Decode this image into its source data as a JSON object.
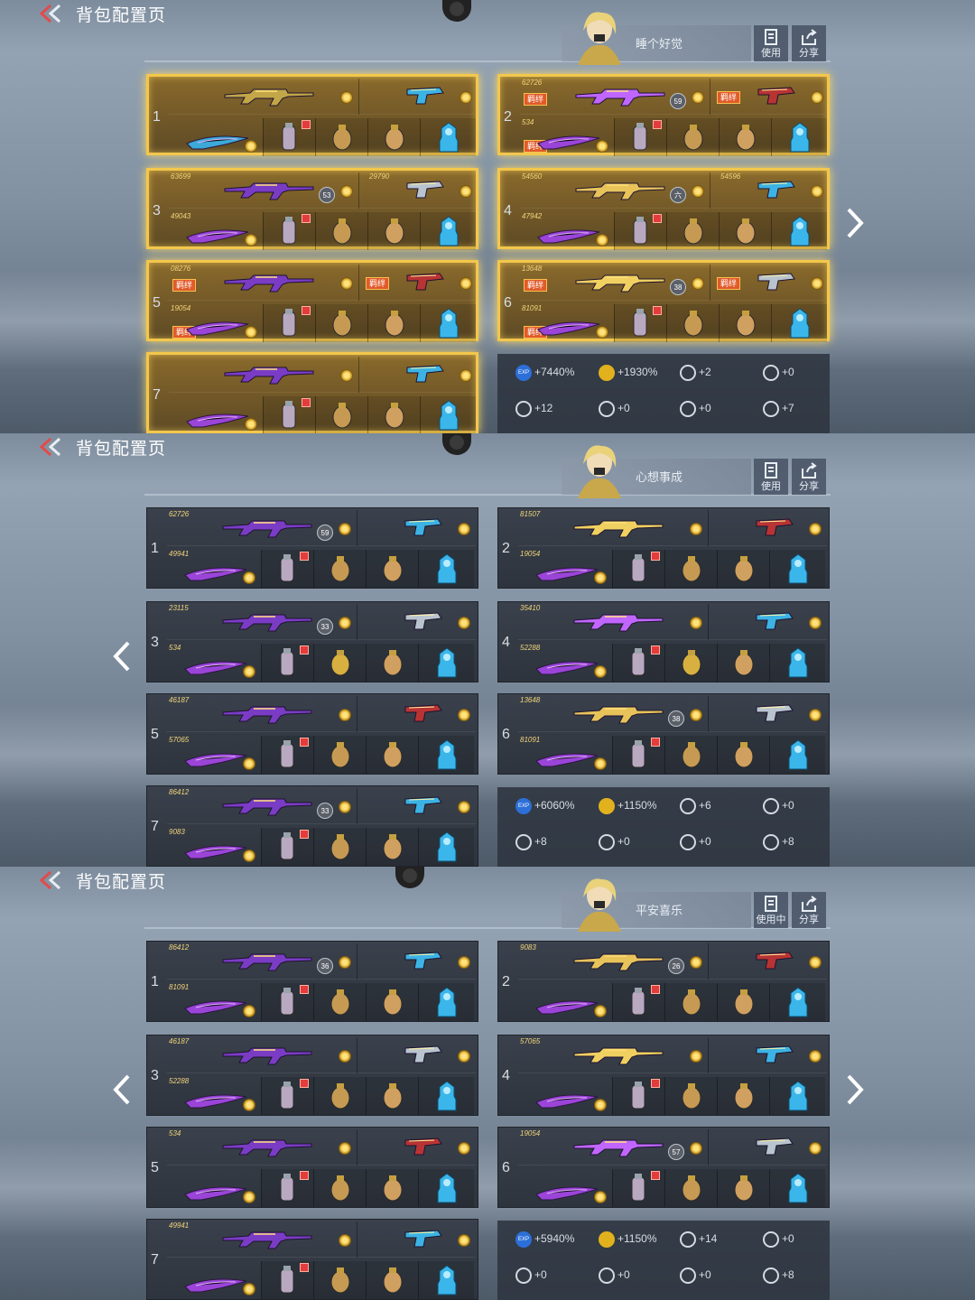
{
  "header": {
    "title": "背包配置页"
  },
  "screens": [
    {
      "profile_name": "睡个好觉",
      "use_label": "使用",
      "share_label": "分享",
      "loadouts": [
        {
          "num": "1",
          "ids": [
            "",
            "",
            "",
            ""
          ],
          "level": "",
          "badges": []
        },
        {
          "num": "2",
          "ids": [
            "62726",
            "534"
          ],
          "level": "59",
          "badges": [
            "羁绊",
            "羁绊",
            "羁绊"
          ]
        },
        {
          "num": "3",
          "ids": [
            "63699",
            "29790",
            "49043"
          ],
          "level": "53",
          "badges": []
        },
        {
          "num": "4",
          "ids": [
            "54560",
            "54596",
            "47942"
          ],
          "level": "六",
          "badges": []
        },
        {
          "num": "5",
          "ids": [
            "08276",
            "19054"
          ],
          "level": "",
          "badges": [
            "羁绊",
            "羁绊",
            "羁绊"
          ]
        },
        {
          "num": "6",
          "ids": [
            "13648",
            "81091"
          ],
          "level": "38",
          "badges": [
            "羁绊",
            "羁绊",
            "羁绊"
          ]
        },
        {
          "num": "7",
          "ids": [],
          "level": "",
          "badges": []
        }
      ],
      "stats": {
        "r1": [
          "+7440%",
          "+1930%",
          "+2",
          "+0"
        ],
        "r2": [
          "+12",
          "+0",
          "+0",
          "+7"
        ]
      }
    },
    {
      "profile_name": "心想事成",
      "use_label": "使用",
      "share_label": "分享",
      "loadouts": [
        {
          "num": "1",
          "ids": [
            "62726",
            "49941"
          ],
          "level": "59",
          "badges": []
        },
        {
          "num": "2",
          "ids": [
            "81507",
            "19054"
          ],
          "level": "",
          "badges": []
        },
        {
          "num": "3",
          "ids": [
            "23115",
            "534"
          ],
          "level": "33",
          "badges": []
        },
        {
          "num": "4",
          "ids": [
            "35410",
            "52288"
          ],
          "level": "",
          "badges": []
        },
        {
          "num": "5",
          "ids": [
            "46187",
            "57065"
          ],
          "level": "",
          "badges": []
        },
        {
          "num": "6",
          "ids": [
            "13648",
            "81091"
          ],
          "level": "38",
          "badges": []
        },
        {
          "num": "7",
          "ids": [
            "86412",
            "9083"
          ],
          "level": "33",
          "badges": []
        }
      ],
      "stats": {
        "r1": [
          "+6060%",
          "+1150%",
          "+6",
          "+0"
        ],
        "r2": [
          "+8",
          "+0",
          "+0",
          "+8"
        ]
      }
    },
    {
      "profile_name": "平安喜乐",
      "use_label": "使用中",
      "share_label": "分享",
      "loadouts": [
        {
          "num": "1",
          "ids": [
            "86412",
            "81091"
          ],
          "level": "36",
          "badges": []
        },
        {
          "num": "2",
          "ids": [
            "9083"
          ],
          "level": "26",
          "badges": []
        },
        {
          "num": "3",
          "ids": [
            "46187",
            "52288"
          ],
          "level": "",
          "badges": []
        },
        {
          "num": "4",
          "ids": [
            "57065"
          ],
          "level": "",
          "badges": []
        },
        {
          "num": "5",
          "ids": [
            "534"
          ],
          "level": "",
          "badges": []
        },
        {
          "num": "6",
          "ids": [
            "19054"
          ],
          "level": "57",
          "badges": []
        },
        {
          "num": "7",
          "ids": [
            "49941"
          ],
          "level": "",
          "badges": []
        }
      ],
      "stats": {
        "r1": [
          "+5940%",
          "+1150%",
          "+14",
          "+0"
        ],
        "r2": [
          "+0",
          "+0",
          "+0",
          "+8"
        ]
      }
    }
  ],
  "colors": {
    "gold": "#f3c74c",
    "purple": "#9a44d8",
    "cyan": "#38b8e8",
    "panel": "#2e343d"
  }
}
